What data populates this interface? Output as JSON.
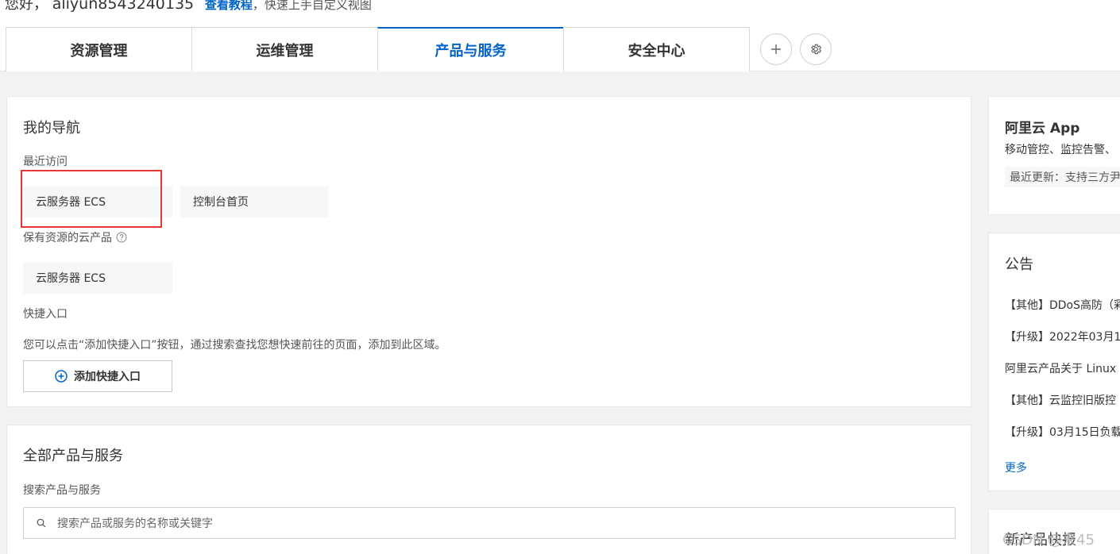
{
  "header": {
    "greeting_prefix": "您好，",
    "username": "aliyun8543240135",
    "tutorial_link": "查看教程",
    "tutorial_tail": "，快速上手自定义视图"
  },
  "tabs": [
    {
      "label": "资源管理"
    },
    {
      "label": "运维管理"
    },
    {
      "label": "产品与服务",
      "active": true
    },
    {
      "label": "安全中心"
    }
  ],
  "tab_actions": {
    "add_icon": "plus-icon",
    "settings_icon": "gear-icon"
  },
  "my_nav": {
    "title": "我的导航",
    "recent_label": "最近访问",
    "recent_items": [
      "云服务器 ECS",
      "控制台首页"
    ],
    "owned_label": "保有资源的云产品",
    "owned_items": [
      "云服务器 ECS"
    ],
    "shortcut_label": "快捷入口",
    "shortcut_hint": "您可以点击“添加快捷入口”按钮，通过搜索查找您想快速前往的页面，添加到此区域。",
    "add_shortcut_button": "添加快捷入口"
  },
  "all_products": {
    "title": "全部产品与服务",
    "search_label": "搜索产品与服务",
    "search_placeholder": "搜索产品或服务的名称或关键字"
  },
  "app_card": {
    "title": "阿里云 App",
    "desc": "移动管控、监控告警、",
    "update": "最近更新：支持三方尹"
  },
  "announcements": {
    "title": "公告",
    "items": [
      "【其他】DDoS高防（彩",
      "【升级】2022年03月1",
      "阿里云产品关于 Linux",
      "【其他】云监控旧版控",
      "【升级】03月15日负载"
    ],
    "more": "更多"
  },
  "new_products": {
    "title": "新产品快报"
  },
  "watermark": "CSDN @来45",
  "colors": {
    "accent": "#0064c8",
    "highlight_box": "#e53935",
    "page_bg": "#f2f2f2"
  }
}
